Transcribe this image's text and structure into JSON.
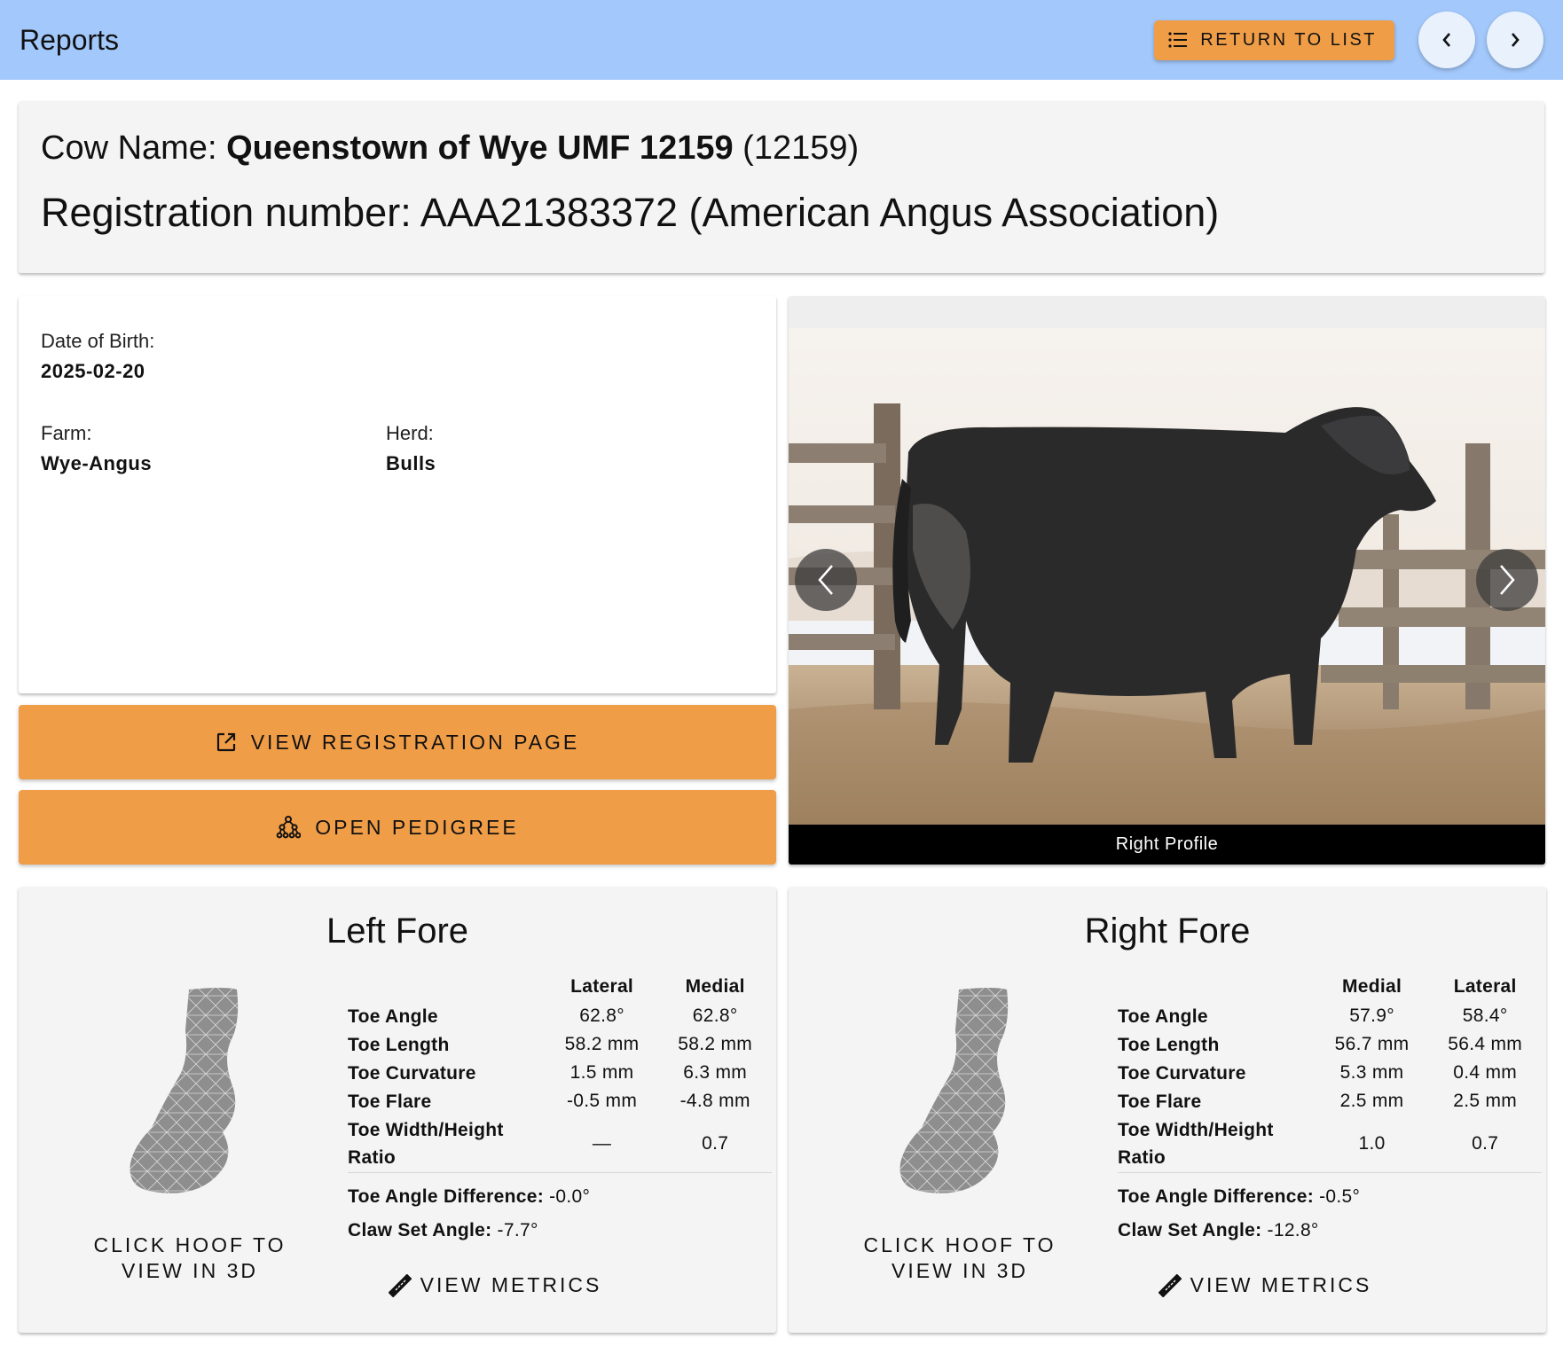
{
  "appbar": {
    "title": "Reports",
    "return_label": "RETURN TO LIST"
  },
  "header": {
    "cow_name_prefix": "Cow Name: ",
    "cow_name": "Queenstown of Wye UMF 12159",
    "cow_id": " (12159)",
    "registration": "Registration number: AAA21383372 (American Angus Association)"
  },
  "info": {
    "dob_label": "Date of Birth:",
    "dob_value": "2025-02-20",
    "farm_label": "Farm:",
    "farm_value": "Wye-Angus",
    "herd_label": "Herd:",
    "herd_value": "Bulls"
  },
  "actions": {
    "registration_label": "VIEW REGISTRATION PAGE",
    "pedigree_label": "OPEN PEDIGREE"
  },
  "photo": {
    "caption": "Right Profile"
  },
  "hooves": [
    {
      "title": "Left Fore",
      "cta": "CLICK HOOF TO VIEW IN 3D",
      "col1": "Lateral",
      "col2": "Medial",
      "rows": [
        {
          "label": "Toe Angle",
          "v1": "62.8°",
          "v2": "62.8°"
        },
        {
          "label": "Toe Length",
          "v1": "58.2 mm",
          "v2": "58.2 mm"
        },
        {
          "label": "Toe Curvature",
          "v1": "1.5 mm",
          "v2": "6.3 mm"
        },
        {
          "label": "Toe Flare",
          "v1": "-0.5 mm",
          "v2": "-4.8 mm"
        },
        {
          "label": "Toe Width/Height Ratio",
          "v1": "—",
          "v2": "0.7"
        }
      ],
      "diff_label": "Toe Angle Difference:",
      "diff_value": " -0.0°",
      "claw_label": "Claw Set Angle:",
      "claw_value": " -7.7°",
      "metrics_label": "VIEW METRICS"
    },
    {
      "title": "Right Fore",
      "cta": "CLICK HOOF TO VIEW IN 3D",
      "col1": "Medial",
      "col2": "Lateral",
      "rows": [
        {
          "label": "Toe Angle",
          "v1": "57.9°",
          "v2": "58.4°"
        },
        {
          "label": "Toe Length",
          "v1": "56.7 mm",
          "v2": "56.4 mm"
        },
        {
          "label": "Toe Curvature",
          "v1": "5.3 mm",
          "v2": "0.4 mm"
        },
        {
          "label": "Toe Flare",
          "v1": "2.5 mm",
          "v2": "2.5 mm"
        },
        {
          "label": "Toe Width/Height Ratio",
          "v1": "1.0",
          "v2": "0.7"
        }
      ],
      "diff_label": "Toe Angle Difference:",
      "diff_value": " -0.5°",
      "claw_label": "Claw Set Angle:",
      "claw_value": " -12.8°",
      "metrics_label": "VIEW METRICS"
    }
  ],
  "colors": {
    "appbar": "#a3c8fb",
    "accent": "#f09d48"
  }
}
